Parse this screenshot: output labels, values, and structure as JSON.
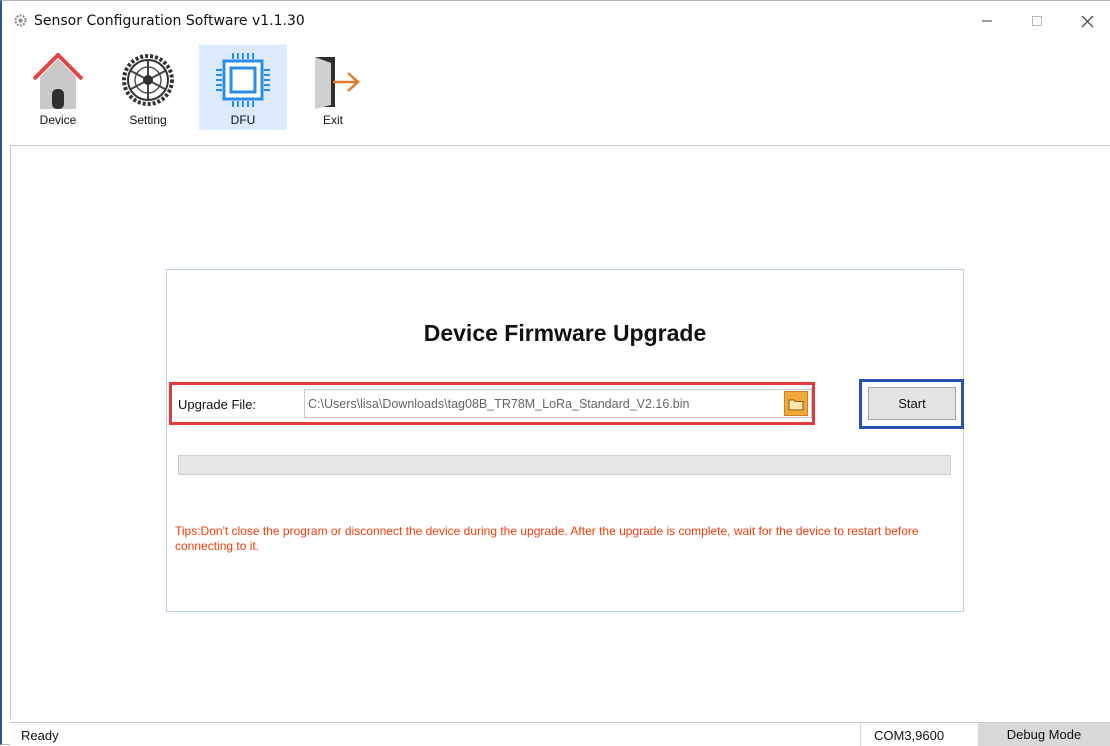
{
  "window": {
    "title": "Sensor Configuration Software v1.1.30"
  },
  "toolbar": {
    "items": [
      {
        "label": "Device",
        "icon": "home-icon"
      },
      {
        "label": "Setting",
        "icon": "gear-icon"
      },
      {
        "label": "DFU",
        "icon": "chip-icon",
        "active": true
      },
      {
        "label": "Exit",
        "icon": "exit-door-icon"
      }
    ]
  },
  "dfu": {
    "title": "Device Firmware Upgrade",
    "file_label": "Upgrade File:",
    "file_path": "C:\\Users\\lisa\\Downloads\\tag08B_TR78M_LoRa_Standard_V2.16.bin",
    "start_label": "Start",
    "progress": 0,
    "tips": "Tips:Don't close the program or disconnect the device during the upgrade. After the upgrade is complete, wait for the device to restart before connecting to it."
  },
  "status": {
    "text": "Ready",
    "port": "COM3,9600",
    "debug_label": "Debug Mode"
  },
  "colors": {
    "accent_active": "#dbeafc",
    "highlight_red": "#e33b3b",
    "highlight_blue": "#2a4fb5",
    "tips": "#f03c0a"
  }
}
